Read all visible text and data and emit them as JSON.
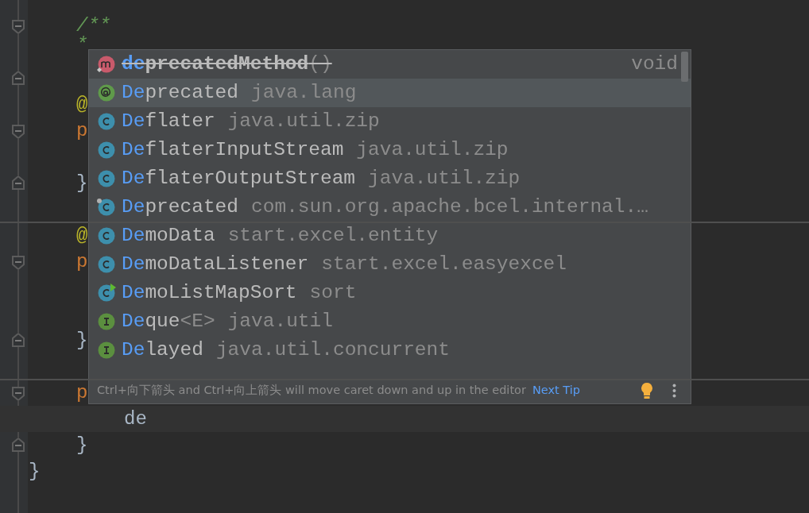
{
  "editor": {
    "lines": [
      {
        "kind": "doc_start",
        "text": "/**",
        "current": false
      },
      {
        "kind": "comment",
        "text": "*",
        "current": false
      },
      {
        "kind": "doc_end",
        "current": false
      },
      {
        "kind": "annotation",
        "text": "@",
        "current": false
      },
      {
        "kind": "keyword",
        "text": "p",
        "current": false,
        "children": [
          {
            "kind": "blank",
            "current": false
          }
        ]
      },
      {
        "kind": "brace",
        "text": "}",
        "current": false
      },
      {
        "kind": "blank",
        "current": false
      },
      {
        "kind": "separator"
      },
      {
        "kind": "annotation",
        "text": "@",
        "current": false
      },
      {
        "kind": "keyword",
        "text": "p",
        "current": false,
        "children": [
          {
            "kind": "blank",
            "current": false
          },
          {
            "kind": "blank",
            "current": false
          }
        ]
      },
      {
        "kind": "brace",
        "text": "}",
        "current": false
      },
      {
        "kind": "blank",
        "current": false
      },
      {
        "kind": "separator"
      },
      {
        "kind": "keyword",
        "text": "p",
        "current": false,
        "children": [
          {
            "kind": "plain",
            "text": "de",
            "current": true
          }
        ]
      },
      {
        "kind": "brace",
        "text": "}",
        "current": false
      },
      {
        "kind": "class_end",
        "text": "}",
        "current": false
      }
    ]
  },
  "completion": {
    "items": [
      {
        "kind": "method",
        "match": "de",
        "rest": "precatedMethod",
        "suffix": "()",
        "type": "void",
        "deprecated": true,
        "selected": false
      },
      {
        "kind": "annotation",
        "match": "De",
        "rest": "precated",
        "location": "java.lang",
        "deprecated": false,
        "selected": true
      },
      {
        "kind": "class",
        "match": "De",
        "rest": "flater",
        "location": "java.util.zip",
        "deprecated": false,
        "selected": false
      },
      {
        "kind": "class",
        "match": "De",
        "rest": "flaterInputStream",
        "location": "java.util.zip",
        "deprecated": false,
        "selected": false
      },
      {
        "kind": "class",
        "match": "De",
        "rest": "flaterOutputStream",
        "location": "java.util.zip",
        "deprecated": false,
        "selected": false
      },
      {
        "kind": "library_class",
        "match": "De",
        "rest": "precated",
        "location": "com.sun.org.apache.bcel.internal.…",
        "deprecated": false,
        "selected": false
      },
      {
        "kind": "class",
        "match": "De",
        "rest": "moData",
        "location": "start.excel.entity",
        "deprecated": false,
        "selected": false
      },
      {
        "kind": "class",
        "match": "De",
        "rest": "moDataListener",
        "location": "start.excel.easyexcel",
        "deprecated": false,
        "selected": false
      },
      {
        "kind": "runnable_class",
        "match": "De",
        "rest": "moListMapSort",
        "location": "sort",
        "deprecated": false,
        "selected": false
      },
      {
        "kind": "interface",
        "match": "De",
        "rest": "que",
        "suffix": "<E>",
        "location": "java.util",
        "deprecated": false,
        "selected": false
      },
      {
        "kind": "interface",
        "match": "De",
        "rest": "layed",
        "location": "java.util.concurrent",
        "deprecated": false,
        "selected": false
      }
    ],
    "tip": "Ctrl+向下箭头 and Ctrl+向上箭头 will move caret down and up in the editor",
    "tip_link": "Next Tip"
  }
}
